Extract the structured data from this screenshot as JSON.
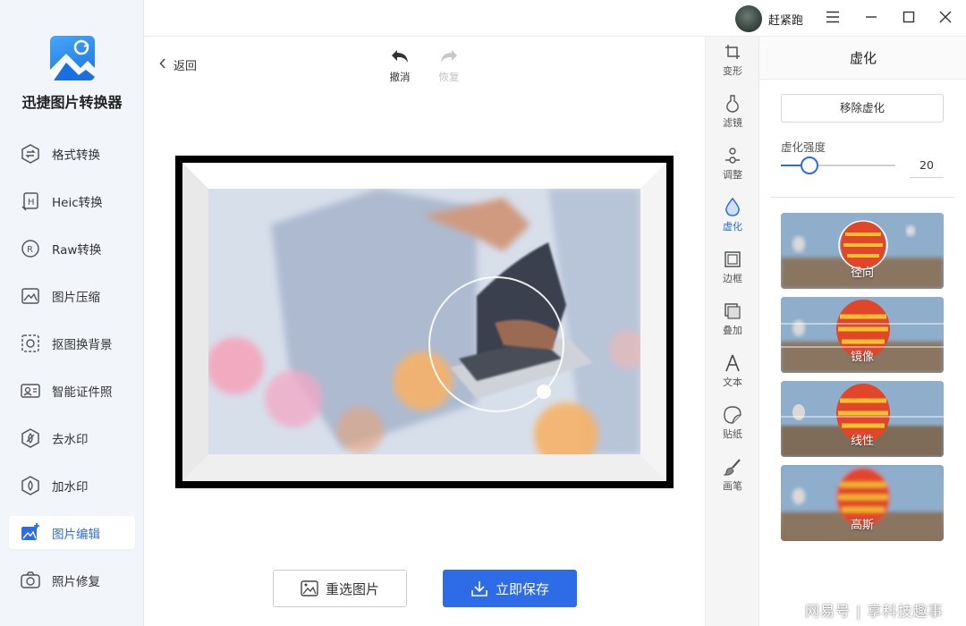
{
  "app": {
    "name": "迅捷图片转换器"
  },
  "sidebar": {
    "items": [
      {
        "label": "格式转换",
        "icon": "format-convert-icon"
      },
      {
        "label": "Heic转换",
        "icon": "heic-icon"
      },
      {
        "label": "Raw转换",
        "icon": "raw-icon"
      },
      {
        "label": "图片压缩",
        "icon": "compress-icon"
      },
      {
        "label": "抠图换背景",
        "icon": "cutout-icon"
      },
      {
        "label": "智能证件照",
        "icon": "id-photo-icon"
      },
      {
        "label": "去水印",
        "icon": "remove-watermark-icon"
      },
      {
        "label": "加水印",
        "icon": "add-watermark-icon"
      },
      {
        "label": "图片编辑",
        "icon": "image-edit-icon",
        "active": true
      },
      {
        "label": "照片修复",
        "icon": "photo-repair-icon"
      }
    ]
  },
  "titlebar": {
    "username": "赶紧跑"
  },
  "editor": {
    "back_label": "返回",
    "undo_label": "撤消",
    "redo_label": "恢复",
    "reselect_label": "重选图片",
    "save_label": "立即保存"
  },
  "toolstrip": {
    "items": [
      {
        "label": "变形",
        "icon": "crop-icon"
      },
      {
        "label": "滤镜",
        "icon": "filter-icon"
      },
      {
        "label": "调整",
        "icon": "adjust-icon"
      },
      {
        "label": "虚化",
        "icon": "blur-drop-icon",
        "active": true
      },
      {
        "label": "边框",
        "icon": "border-icon"
      },
      {
        "label": "叠加",
        "icon": "overlay-icon"
      },
      {
        "label": "文本",
        "icon": "text-icon"
      },
      {
        "label": "贴纸",
        "icon": "sticker-icon"
      },
      {
        "label": "画笔",
        "icon": "brush-icon"
      }
    ]
  },
  "panel": {
    "title": "虚化",
    "remove_label": "移除虚化",
    "strength_label": "虚化强度",
    "strength_value": "20",
    "strength_fraction": 0.25,
    "styles": [
      {
        "label": "径向"
      },
      {
        "label": "镜像"
      },
      {
        "label": "线性"
      },
      {
        "label": "高斯"
      }
    ]
  },
  "colors": {
    "accent": "#2e6be6"
  },
  "watermark": "网易号 | 享科技趣事"
}
